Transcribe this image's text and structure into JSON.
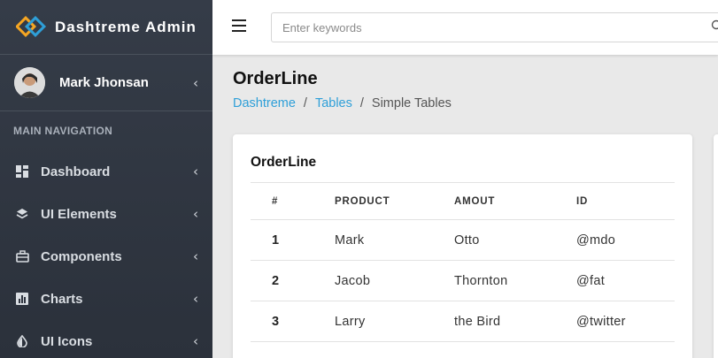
{
  "brand": {
    "name": "Dashtreme Admin"
  },
  "user": {
    "name": "Mark Jhonsan"
  },
  "sidebar": {
    "header": "MAIN NAVIGATION",
    "items": [
      {
        "label": "Dashboard",
        "icon": "dashboard-icon"
      },
      {
        "label": "UI Elements",
        "icon": "layers-icon"
      },
      {
        "label": "Components",
        "icon": "briefcase-icon"
      },
      {
        "label": "Charts",
        "icon": "bar-chart-icon"
      },
      {
        "label": "UI Icons",
        "icon": "drop-icon"
      }
    ]
  },
  "search": {
    "placeholder": "Enter keywords"
  },
  "page": {
    "title": "OrderLine",
    "breadcrumb": [
      "Dashtreme",
      "Tables",
      "Simple Tables"
    ]
  },
  "card": {
    "title": "OrderLine",
    "columns": [
      "#",
      "PRODUCT",
      "AMOUT",
      "ID"
    ],
    "rows": [
      [
        "1",
        "Mark",
        "Otto",
        "@mdo"
      ],
      [
        "2",
        "Jacob",
        "Thornton",
        "@fat"
      ],
      [
        "3",
        "Larry",
        "the Bird",
        "@twitter"
      ]
    ]
  },
  "colors": {
    "sidebar": "#2f3540",
    "link": "#2e9fd8",
    "logo_orange": "#f5a623",
    "logo_blue": "#2e9fd8"
  }
}
